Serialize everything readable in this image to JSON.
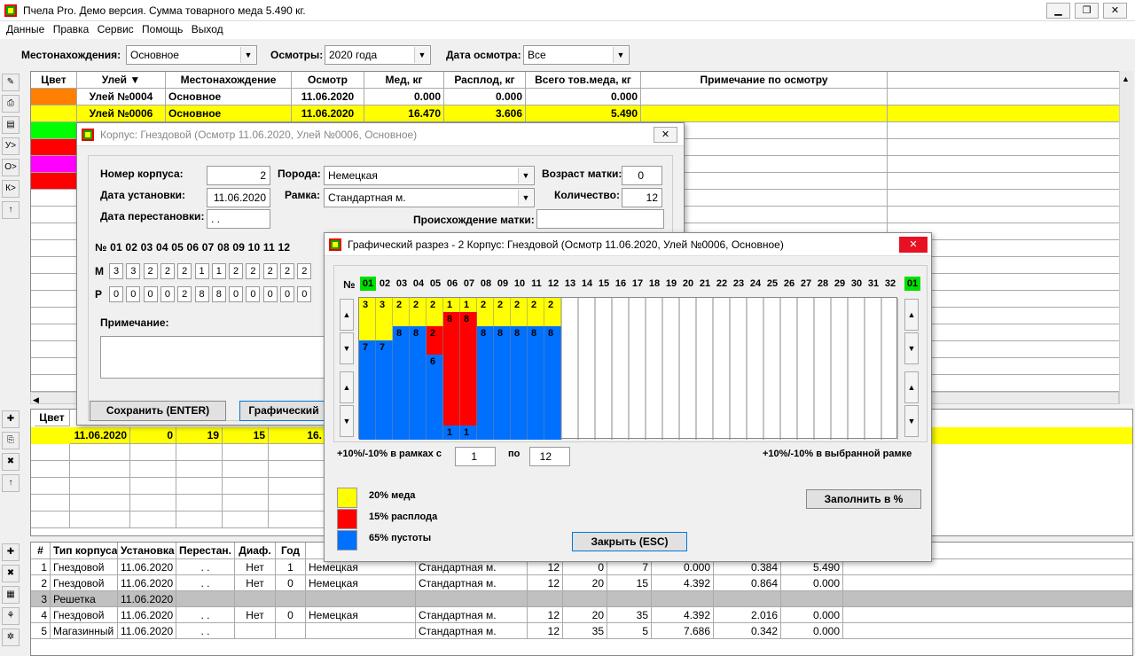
{
  "window": {
    "title": "Пчела Pro. Демо версия. Сумма товарного меда 5.490 кг.",
    "min": "▁",
    "max": "❐",
    "close": "✕"
  },
  "menu": [
    "Данные",
    "Правка",
    "Сервис",
    "Помощь",
    "Выход"
  ],
  "filters": {
    "location_label": "Местонахождения:",
    "location": "Основное",
    "inspections_label": "Осмотры:",
    "inspections": "2020 года",
    "date_label": "Дата осмотра:",
    "date": "Все"
  },
  "toolbar_top": [
    "✎",
    "⎙",
    "▤",
    "У>",
    "О>",
    "К>",
    "↑"
  ],
  "hives": {
    "headers": [
      "Цвет",
      "Улей ▼",
      "Местонахождение",
      "Осмотр",
      "Мед, кг",
      "Расплод, кг",
      "Всего тов.меда, кг",
      "Примечание по осмотру"
    ],
    "colors": [
      "#ff8000",
      "#ffff00",
      "#00ff00",
      "#ff0000",
      "#ff00ff",
      "#ff0000"
    ],
    "rows": [
      [
        "Улей №0004",
        "Основное",
        "11.06.2020",
        "0.000",
        "0.000",
        "0.000"
      ],
      [
        "Улей №0006",
        "Основное",
        "11.06.2020",
        "16.470",
        "3.606",
        "5.490"
      ]
    ]
  },
  "toolbar_mid": [
    "✚",
    "⎘",
    "✖",
    "↑"
  ],
  "mid": {
    "h0": "Цвет",
    "row": [
      "11.06.2020",
      "0",
      "19",
      "15",
      "16."
    ]
  },
  "toolbar_bot": [
    "✚",
    "✖",
    "▦",
    "⚘",
    "✲"
  ],
  "bodies": {
    "headers": [
      "#",
      "Тип корпуса",
      "Установка",
      "Перестан.",
      "Диаф.",
      "Год"
    ],
    "rows": [
      [
        "1",
        "Гнездовой",
        "11.06.2020",
        ". .",
        "Нет",
        "1",
        "Немецкая",
        "Стандартная м.",
        "12",
        "0",
        "7",
        "0.000",
        "0.384",
        "5.490"
      ],
      [
        "2",
        "Гнездовой",
        "11.06.2020",
        ". .",
        "Нет",
        "0",
        "Немецкая",
        "Стандартная м.",
        "12",
        "20",
        "15",
        "4.392",
        "0.864",
        "0.000"
      ],
      [
        "3",
        "Решетка",
        "11.06.2020",
        "",
        "",
        "",
        "",
        "",
        "",
        "",
        "",
        "",
        "",
        ""
      ],
      [
        "4",
        "Гнездовой",
        "11.06.2020",
        ". .",
        "Нет",
        "0",
        "Немецкая",
        "Стандартная м.",
        "12",
        "20",
        "35",
        "4.392",
        "2.016",
        "0.000"
      ],
      [
        "5",
        "Магазинный",
        "11.06.2020",
        ". .",
        "",
        "",
        "",
        "Стандартная м.",
        "12",
        "35",
        "5",
        "7.686",
        "0.342",
        "0.000"
      ]
    ],
    "pointer": "▶"
  },
  "corpus": {
    "title": "Корпус: Гнездовой (Осмотр 11.06.2020, Улей №0006, Основное)",
    "close": "✕",
    "num_label": "Номер корпуса:",
    "num": "2",
    "inst_label": "Дата установки:",
    "inst": "11.06.2020",
    "move_label": "Дата перестановки:",
    "move": ". .",
    "breed_label": "Порода:",
    "breed": "Немецкая",
    "frame_label": "Рамка:",
    "frame": "Стандартная м.",
    "age_label": "Возраст матки:",
    "age": "0",
    "qty_label": "Количество:",
    "qty": "12",
    "origin_label": "Происхождение матки:",
    "nums_label": "№ 01 02 03 04 05 06 07 08 09 10 11 12",
    "m_label": "М",
    "m": [
      "3",
      "3",
      "2",
      "2",
      "2",
      "1",
      "1",
      "2",
      "2",
      "2",
      "2",
      "2"
    ],
    "p_label": "Р",
    "p": [
      "0",
      "0",
      "0",
      "0",
      "2",
      "8",
      "8",
      "0",
      "0",
      "0",
      "0",
      "0"
    ],
    "note_label": "Примечание:",
    "save": "Сохранить (ENTER)",
    "graph": "Графический"
  },
  "graph": {
    "title": "Графический разрез - 2 Корпус: Гнездовой (Осмотр 11.06.2020, Улей №0006, Основное)",
    "close": "✕",
    "no": "№",
    "cols": [
      "01",
      "02",
      "03",
      "04",
      "05",
      "06",
      "07",
      "08",
      "09",
      "10",
      "11",
      "12",
      "13",
      "14",
      "15",
      "16",
      "17",
      "18",
      "19",
      "20",
      "21",
      "22",
      "23",
      "24",
      "25",
      "26",
      "27",
      "28",
      "29",
      "30",
      "31",
      "32"
    ],
    "last": "01",
    "frames": [
      {
        "m": 3,
        "p": 0,
        "e": 7,
        "labels": {
          "m": "3",
          "e": "7"
        }
      },
      {
        "m": 3,
        "p": 0,
        "e": 7,
        "labels": {
          "m": "3",
          "e": "7"
        }
      },
      {
        "m": 2,
        "p": 0,
        "e": 8,
        "labels": {
          "m": "2",
          "e": "8"
        }
      },
      {
        "m": 2,
        "p": 0,
        "e": 8,
        "labels": {
          "m": "2",
          "e": "8"
        }
      },
      {
        "m": 2,
        "p": 2,
        "e": 6,
        "labels": {
          "m": "2",
          "p": "2",
          "e": "6"
        }
      },
      {
        "m": 1,
        "p": 8,
        "e": 1,
        "labels": {
          "m": "1",
          "p": "8",
          "e": "1"
        }
      },
      {
        "m": 1,
        "p": 8,
        "e": 1,
        "labels": {
          "m": "1",
          "p": "8",
          "e": "1"
        }
      },
      {
        "m": 2,
        "p": 0,
        "e": 8,
        "labels": {
          "m": "2",
          "e": "8"
        }
      },
      {
        "m": 2,
        "p": 0,
        "e": 8,
        "labels": {
          "m": "2",
          "e": "8"
        }
      },
      {
        "m": 2,
        "p": 0,
        "e": 8,
        "labels": {
          "m": "2",
          "e": "8"
        }
      },
      {
        "m": 2,
        "p": 0,
        "e": 8,
        "labels": {
          "m": "2",
          "e": "8"
        }
      },
      {
        "m": 2,
        "p": 0,
        "e": 8,
        "labels": {
          "m": "2",
          "e": "8"
        }
      }
    ],
    "range_label": "+10%/-10% в рамках с",
    "from": "1",
    "to_label": "по",
    "to": "12",
    "sel_label": "+10%/-10% в выбранной рамке",
    "honey": "20% меда",
    "brood": "15% расплода",
    "empty": "65% пустоты",
    "fill": "Заполнить в %",
    "closebtn": "Закрыть (ESC)",
    "colors": {
      "honey": "#ffff00",
      "brood": "#ff0000",
      "empty": "#0070ff"
    }
  }
}
